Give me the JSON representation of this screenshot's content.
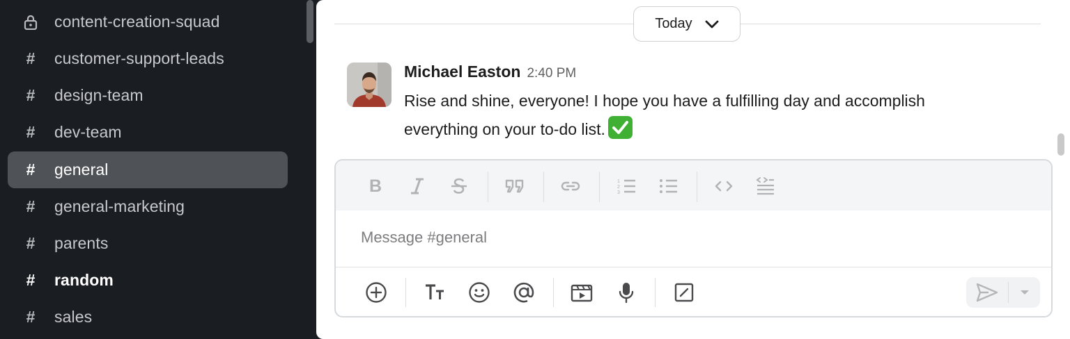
{
  "sidebar": {
    "channels": [
      {
        "label": "content-creation-squad",
        "icon": "lock-icon",
        "state": "normal"
      },
      {
        "label": "customer-support-leads",
        "icon": "hash-icon",
        "state": "normal"
      },
      {
        "label": "design-team",
        "icon": "hash-icon",
        "state": "normal"
      },
      {
        "label": "dev-team",
        "icon": "hash-icon",
        "state": "normal"
      },
      {
        "label": "general",
        "icon": "hash-icon",
        "state": "active"
      },
      {
        "label": "general-marketing",
        "icon": "hash-icon",
        "state": "normal"
      },
      {
        "label": "parents",
        "icon": "hash-icon",
        "state": "normal"
      },
      {
        "label": "random",
        "icon": "hash-icon",
        "state": "unread"
      },
      {
        "label": "sales",
        "icon": "hash-icon",
        "state": "normal"
      }
    ]
  },
  "day_divider": {
    "label": "Today"
  },
  "message": {
    "author": "Michael Easton",
    "time": "2:40 PM",
    "text": "Rise and shine, everyone! I hope you have a fulfilling day and accomplish everything on your to-do list.",
    "emoji": "white-check-mark-icon"
  },
  "composer": {
    "placeholder": "Message #general",
    "format_tools": [
      "bold-icon",
      "italic-icon",
      "strikethrough-icon",
      "quote-icon",
      "link-icon",
      "ordered-list-icon",
      "bulleted-list-icon",
      "code-icon",
      "code-block-icon"
    ],
    "actions": [
      "plus-icon",
      "text-format-icon",
      "emoji-icon",
      "mention-icon",
      "video-icon",
      "microphone-icon",
      "slash-command-icon"
    ],
    "send": "send-icon"
  },
  "colors": {
    "sidebar_bg": "#1a1d21",
    "active_channel_bg": "#4f5256",
    "emoji_green": "#3fb034"
  }
}
